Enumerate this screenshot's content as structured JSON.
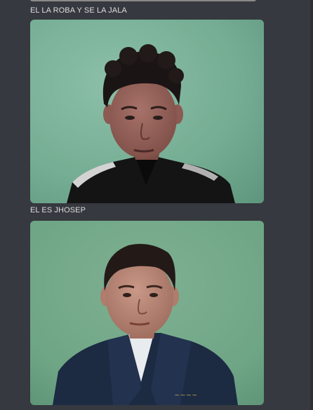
{
  "messages": [
    {
      "caption": "EL LA ROBA Y SE LA JALA",
      "attachment": {
        "type": "image",
        "subject": "young man with curly dark hair in black jacket against green wall"
      }
    },
    {
      "caption": "EL ES JHOSEP",
      "attachment": {
        "type": "image",
        "subject": "young man with short dark hair in navy school jacket against green wall"
      }
    }
  ],
  "colors": {
    "background": "#36393f",
    "text": "#dcddde",
    "wall_green": "#6fa88f"
  }
}
